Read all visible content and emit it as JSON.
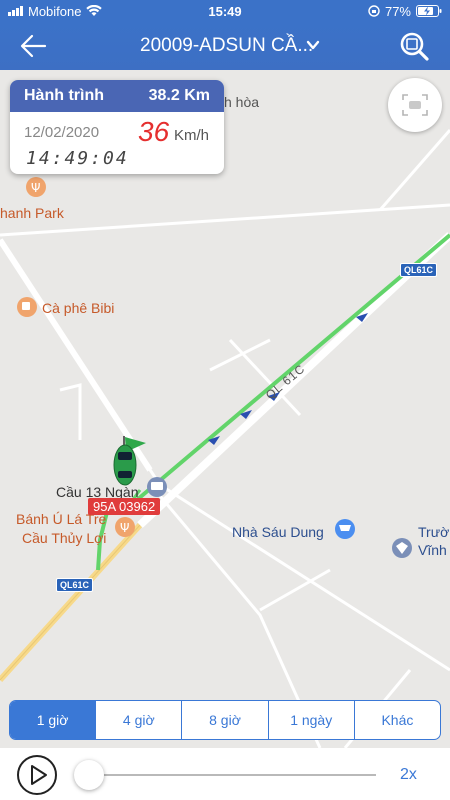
{
  "statusbar": {
    "carrier": "Mobifone",
    "time": "15:49",
    "battery": "77%"
  },
  "header": {
    "title": "20009-ADSUN CẦ..."
  },
  "trip": {
    "label": "Hành trình",
    "distance": "38.2 Km",
    "date": "12/02/2020",
    "time": "14:49:04",
    "speed": "36",
    "speed_unit": "Km/h"
  },
  "map": {
    "pois": {
      "hoa": "h hòa",
      "park": "hanh Park",
      "cafe": "Cà phê Bibi",
      "cau13": "Cầu 13 Ngàn",
      "banh_line1": "Bánh Ú Lá Tre",
      "banh_line2": "Cầu Thủy Lợi",
      "nha_sau_dung": "Nhà Sáu Dung",
      "truong_line1": "Trườ",
      "truong_line2": "Vĩnh"
    },
    "road_label": "QL 61C",
    "shield_top": "QL61C",
    "shield_bottom": "QL61C",
    "plate": "95A 03962",
    "colors": {
      "route": "#62d46a",
      "highway": "#f7d98a",
      "accent": "#3a78d6"
    }
  },
  "range": {
    "options": [
      "1 giờ",
      "4 giờ",
      "8 giờ",
      "1 ngày",
      "Khác"
    ],
    "selected": "1 giờ"
  },
  "player": {
    "speed": "2x",
    "progress": 0.0
  }
}
